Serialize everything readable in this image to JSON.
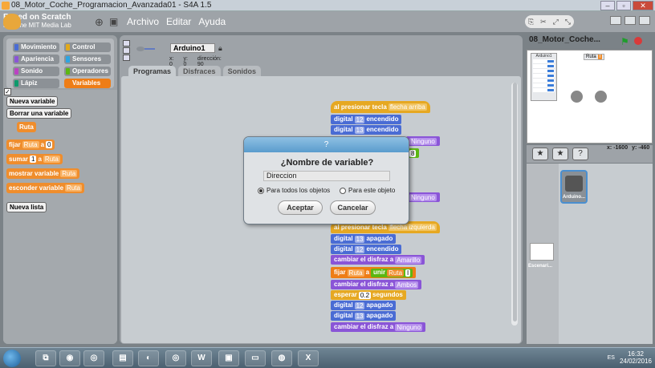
{
  "window": {
    "title": "08_Motor_Coche_Programacion_Avanzada01 - S4A 1.5"
  },
  "logo": {
    "line1": "Based on Scratch",
    "line2": "from the MIT Media Lab"
  },
  "menu": {
    "items": [
      "Archivo",
      "Editar",
      "Ayuda"
    ]
  },
  "palette": {
    "categories": [
      {
        "label": "Movimiento",
        "color": "#4a6cd4"
      },
      {
        "label": "Control",
        "color": "#e1a91a"
      },
      {
        "label": "Apariencia",
        "color": "#8a55d7"
      },
      {
        "label": "Sensores",
        "color": "#2ca5e2"
      },
      {
        "label": "Sonido",
        "color": "#bb42c3"
      },
      {
        "label": "Operadores",
        "color": "#5cb712"
      },
      {
        "label": "Lápiz",
        "color": "#0e9a6c"
      },
      {
        "label": "Variables",
        "color": "#ee7d16"
      }
    ],
    "new_variable_label": "Nueva variable",
    "delete_variable_label": "Borrar una variable",
    "variable_name": "Ruta",
    "blocks": {
      "set": {
        "verb": "fijar",
        "var": "Ruta",
        "prep": "a",
        "value": "0"
      },
      "change": {
        "verb": "sumar",
        "value": "1",
        "prep": "a",
        "var": "Ruta"
      },
      "show": {
        "verb": "mostrar variable",
        "var": "Ruta"
      },
      "hide": {
        "verb": "esconder variable",
        "var": "Ruta"
      }
    },
    "new_list_label": "Nueva lista"
  },
  "sprite_header": {
    "name": "Arduino1",
    "x_label": "x:",
    "x_value": "0",
    "y_label": "y:",
    "y_value": "0",
    "dir_label": "dirección:",
    "dir_value": "90"
  },
  "tabs": [
    "Programas",
    "Disfraces",
    "Sonidos"
  ],
  "scripts": {
    "s1_hat": {
      "text": "al presionar tecla",
      "key": "flecha arriba"
    },
    "s1_d1": {
      "text": "digital",
      "pin": "12",
      "state": "encendido"
    },
    "s1_d2": {
      "text": "digital",
      "pin": "13",
      "state": "encendido"
    },
    "s1_partial": "Ninguno",
    "s1_val": "8",
    "s1_partial2": "Ninguno",
    "s2_hat": {
      "text": "al presionar tecla",
      "key": "flecha izquierda"
    },
    "s2_d1": {
      "text": "digital",
      "pin": "13",
      "state": "apagado"
    },
    "s2_d2": {
      "text": "digital",
      "pin": "12",
      "state": "encendido"
    },
    "s2_costume1": {
      "text": "cambiar el disfraz a",
      "value": "Amarillo"
    },
    "s2_set": {
      "verb": "fijar",
      "var": "Ruta",
      "prep": "a",
      "join": "unir",
      "a": "Ruta",
      "b": "I"
    },
    "s2_costume2": {
      "text": "cambiar el disfraz a",
      "value": "Ambos"
    },
    "s2_wait": {
      "text": "esperar",
      "value": "0.2",
      "unit": "segundos"
    },
    "s2_d3": {
      "text": "digital",
      "pin": "12",
      "state": "apagado"
    },
    "s2_d4": {
      "text": "digital",
      "pin": "13",
      "state": "apagado"
    },
    "s2_costume3": {
      "text": "cambiar el disfraz a",
      "value": "Ninguno"
    }
  },
  "dialog": {
    "header": "?",
    "title": "¿Nombre de variable?",
    "input_value": "Direccion",
    "radio_all": "Para todos los objetos",
    "radio_this": "Para este objeto",
    "accept": "Aceptar",
    "cancel": "Cancelar"
  },
  "stage": {
    "project_name": "08_Motor_Coche...",
    "monitor_label": "Ruta",
    "monitor_value": "I",
    "sensor_header": "Arduino1",
    "mouse_x_label": "x:",
    "mouse_x": "-1600",
    "mouse_y_label": "y:",
    "mouse_y": "-460"
  },
  "sprites": {
    "selected_name": "Arduino...",
    "stage_label": "Escenari..."
  },
  "taskbar": {
    "lang": "ES",
    "time": "16:32",
    "date": "24/02/2016"
  }
}
